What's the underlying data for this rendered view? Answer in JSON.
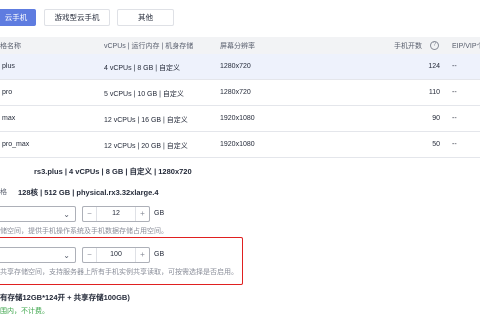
{
  "tabs": [
    {
      "label": "云手机",
      "active": true
    },
    {
      "label": "游戏型云手机",
      "active": false
    },
    {
      "label": "其他",
      "active": false
    }
  ],
  "table": {
    "headers": {
      "name": "格名称",
      "spec": "vCPUs | 运行内存 | 机身存储",
      "resolution": "屏幕分辨率",
      "phones": "手机开数",
      "eip": "EIP/VIP个"
    },
    "rows": [
      {
        "name": "plus",
        "spec": "4 vCPUs | 8 GB | 自定义",
        "resolution": "1280x720",
        "phones": "124",
        "eip": "--",
        "selected": true
      },
      {
        "name": "pro",
        "spec": "5 vCPUs | 10 GB | 自定义",
        "resolution": "1280x720",
        "phones": "110",
        "eip": "--",
        "selected": false
      },
      {
        "name": "max",
        "spec": "12 vCPUs | 16 GB | 自定义",
        "resolution": "1920x1080",
        "phones": "90",
        "eip": "--",
        "selected": false
      },
      {
        "name": "pro_max",
        "spec": "12 vCPUs | 20 GB | 自定义",
        "resolution": "1920x1080",
        "phones": "50",
        "eip": "--",
        "selected": false
      }
    ]
  },
  "selected_spec": {
    "phone_spec": "rs3.plus | 4 vCPUs | 8 GB | 自定义 | 1280x720",
    "server_label": "格",
    "server_spec": "128核 | 512 GB | physical.rx3.32xlarge.4"
  },
  "storage1": {
    "value": "12",
    "unit": "GB",
    "hint": "储空间，提供手机操作系统及手机数据存储占用空间。"
  },
  "storage2": {
    "value": "100",
    "unit": "GB",
    "hint": "共享存储空间，支持服务器上所有手机实例共享读取，可按需选择是否启用。"
  },
  "summary": {
    "total": "有存储12GB*124开 + 共享存储100GB)",
    "note": "围内，不计费。"
  },
  "colors": {
    "accent": "#5e7ce0",
    "highlight_border": "#e02020",
    "note_green": "#3ba54a"
  }
}
